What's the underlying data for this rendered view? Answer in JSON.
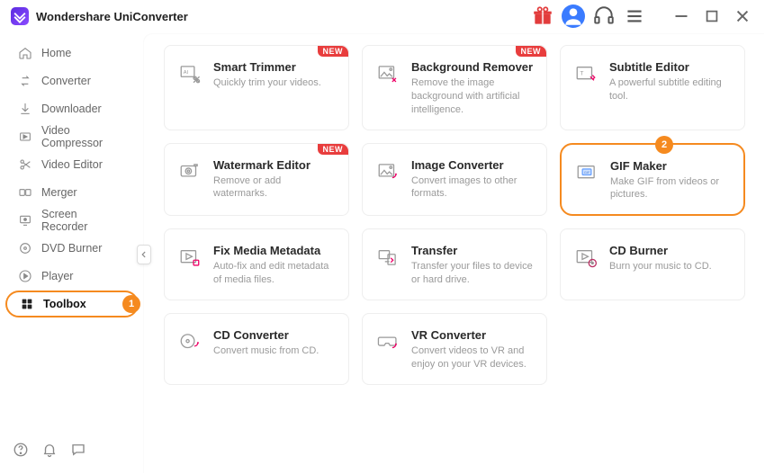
{
  "app": {
    "title": "Wondershare UniConverter"
  },
  "callouts": {
    "sidebar": "1",
    "card": "2"
  },
  "badges": {
    "new": "NEW"
  },
  "sidebar": {
    "items": [
      {
        "label": "Home"
      },
      {
        "label": "Converter"
      },
      {
        "label": "Downloader"
      },
      {
        "label": "Video Compressor"
      },
      {
        "label": "Video Editor"
      },
      {
        "label": "Merger"
      },
      {
        "label": "Screen Recorder"
      },
      {
        "label": "DVD Burner"
      },
      {
        "label": "Player"
      },
      {
        "label": "Toolbox"
      }
    ]
  },
  "tools": [
    {
      "title": "Smart Trimmer",
      "desc": "Quickly trim your videos.",
      "new": true
    },
    {
      "title": "Background Remover",
      "desc": "Remove the image background with artificial intelligence.",
      "new": true
    },
    {
      "title": "Subtitle Editor",
      "desc": "A powerful subtitle editing tool."
    },
    {
      "title": "Watermark Editor",
      "desc": "Remove or add watermarks.",
      "new": true
    },
    {
      "title": "Image Converter",
      "desc": "Convert images to other formats."
    },
    {
      "title": "GIF Maker",
      "desc": "Make GIF from videos or pictures.",
      "highlight": true
    },
    {
      "title": "Fix Media Metadata",
      "desc": "Auto-fix and edit metadata of media files."
    },
    {
      "title": "Transfer",
      "desc": "Transfer your files to device or hard drive."
    },
    {
      "title": "CD Burner",
      "desc": "Burn your music to CD."
    },
    {
      "title": "CD Converter",
      "desc": "Convert music from CD."
    },
    {
      "title": "VR Converter",
      "desc": "Convert videos to VR and enjoy on your VR devices."
    }
  ]
}
